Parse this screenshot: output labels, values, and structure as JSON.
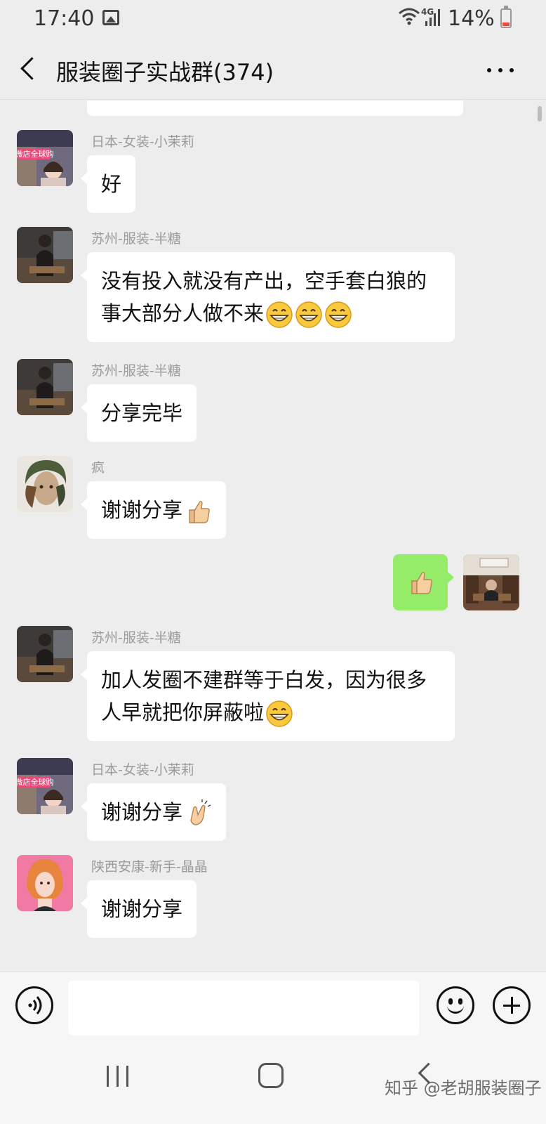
{
  "status_bar": {
    "time": "17:40",
    "network": "4G",
    "battery": "14%",
    "icons": [
      "gallery-icon",
      "wifi-icon",
      "signal-icon",
      "battery-icon"
    ]
  },
  "header": {
    "title": "服装圈子实战群(374)",
    "back_icon": "chevron-left-icon",
    "more_icon": "more-dots-icon"
  },
  "messages": [
    {
      "sender": "日本-女装-小茉莉",
      "avatar": "avatar-xiaomoli",
      "text": "好"
    },
    {
      "sender": "苏州-服装-半糖",
      "avatar": "avatar-bantang",
      "text": "没有投入就没有产出，空手套白狼的事大部分人做不来",
      "emojis": [
        "grin",
        "grin",
        "grin"
      ]
    },
    {
      "sender": "苏州-服装-半糖",
      "avatar": "avatar-bantang",
      "text": "分享完毕"
    },
    {
      "sender": "疯",
      "avatar": "avatar-feng",
      "text": "谢谢分享",
      "emojis": [
        "thumbs-up"
      ]
    },
    {
      "sender": "",
      "avatar": "avatar-self",
      "outgoing": true,
      "emojis": [
        "thumbs-up"
      ]
    },
    {
      "sender": "苏州-服装-半糖",
      "avatar": "avatar-bantang",
      "text": "加人发圈不建群等于白发，因为很多人早就把你屏蔽啦",
      "emojis": [
        "grin"
      ]
    },
    {
      "sender": "日本-女装-小茉莉",
      "avatar": "avatar-xiaomoli",
      "text": "谢谢分享",
      "emojis": [
        "clap"
      ]
    },
    {
      "sender": "陕西安康-新手-晶晶",
      "avatar": "avatar-jingjing",
      "text": "谢谢分享"
    }
  ],
  "avatar_labels": {
    "xiaomoli_text": "微店全球购"
  },
  "input_bar": {
    "placeholder": "",
    "icons": [
      "voice-icon",
      "emoji-icon",
      "plus-icon"
    ]
  },
  "nav_bar": {
    "icons": [
      "recent-apps-icon",
      "home-icon",
      "back-icon"
    ]
  },
  "watermark": "知乎 @老胡服装圈子",
  "colors": {
    "background": "#ededed",
    "bubble_in": "#ffffff",
    "bubble_out": "#95ec69",
    "sender_name": "#9b9b9b"
  }
}
